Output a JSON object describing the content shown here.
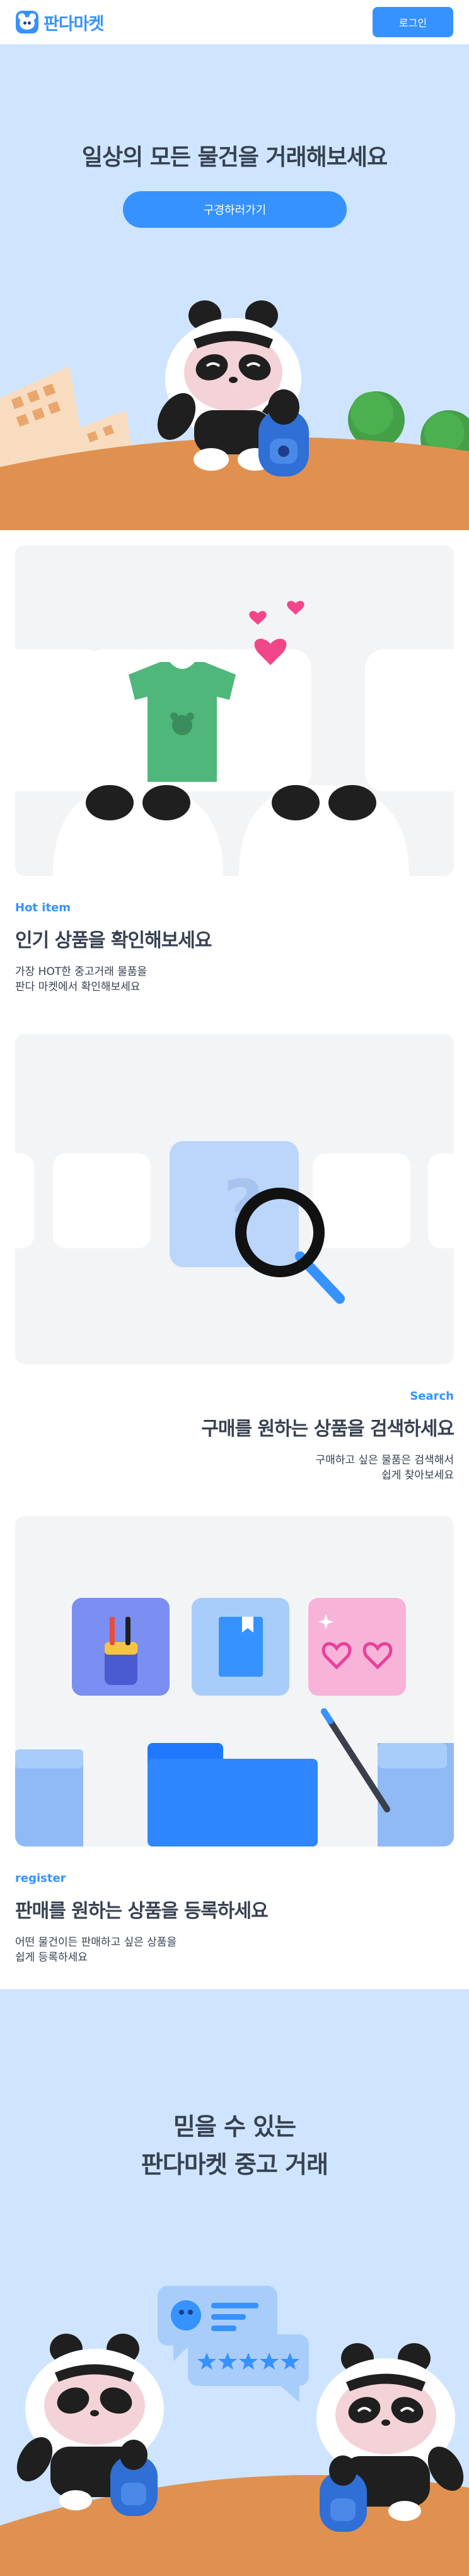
{
  "header": {
    "logo_text": "판다마켓",
    "login_label": "로그인"
  },
  "hero": {
    "title": "일상의 모든 물건을 거래해보세요",
    "cta_label": "구경하러가기"
  },
  "features": [
    {
      "tag": "Hot item",
      "title": "인기 상품을 확인해보세요",
      "desc_line1": "가장 HOT한 중고거래 물품을",
      "desc_line2": "판다 마켓에서 확인해보세요"
    },
    {
      "tag": "Search",
      "title": "구매를 원하는 상품을 검색하세요",
      "desc_line1": "구매하고 싶은 물품은 검색해서",
      "desc_line2": "쉽게 찾아보세요"
    },
    {
      "tag": "register",
      "title": "판매를 원하는 상품을 등록하세요",
      "desc_line1": "어떤 물건이든 판매하고 싶은 상품을",
      "desc_line2": "쉽게 등록하세요"
    }
  ],
  "bottom": {
    "title_line1": "믿을 수 있는",
    "title_line2": "판다마켓 중고 거래"
  },
  "colors": {
    "brand_blue": "#3692ff",
    "sky": "#cfe5ff",
    "ground": "#e0914f",
    "card_bg": "#f3f4f6"
  }
}
